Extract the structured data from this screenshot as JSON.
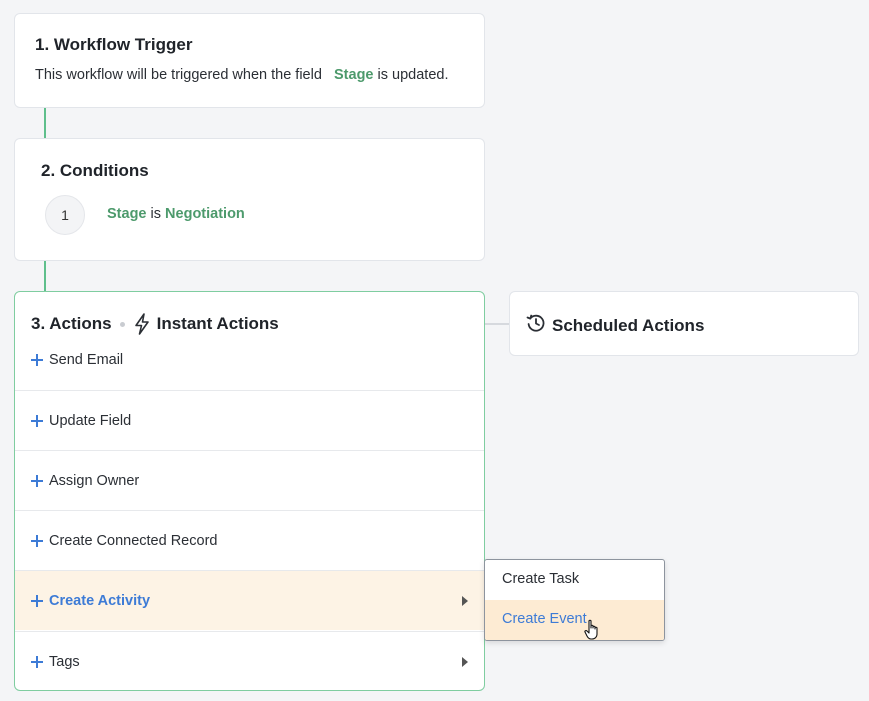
{
  "trigger": {
    "title": "1. Workflow Trigger",
    "text_before": "This workflow will be triggered when the field",
    "field": "Stage",
    "text_after": "is updated."
  },
  "conditions": {
    "title": "2. Conditions",
    "items": [
      {
        "number": "1",
        "field": "Stage",
        "operator": "is",
        "value": "Negotiation"
      }
    ]
  },
  "actions": {
    "title": "3. Actions",
    "instant_label": "Instant Actions",
    "instant_icon": "lightning-bolt-icon",
    "items": [
      {
        "label": "Send Email"
      },
      {
        "label": "Update Field"
      },
      {
        "label": "Assign Owner"
      },
      {
        "label": "Create Connected Record"
      },
      {
        "label": "Create Activity",
        "has_submenu": true,
        "highlighted": true
      },
      {
        "label": "Tags",
        "has_submenu": true
      }
    ]
  },
  "scheduled": {
    "label": "Scheduled Actions",
    "icon": "clock-refresh-icon"
  },
  "submenu": {
    "items": [
      {
        "label": "Create Task"
      },
      {
        "label": "Create Event",
        "active": true
      }
    ]
  },
  "colors": {
    "accent_green": "#4d9a6c",
    "connector_green": "#5fbf8c",
    "link_blue": "#3d7bd6",
    "highlight": "#fdf3e5",
    "submenu_active": "#fdebd3"
  }
}
